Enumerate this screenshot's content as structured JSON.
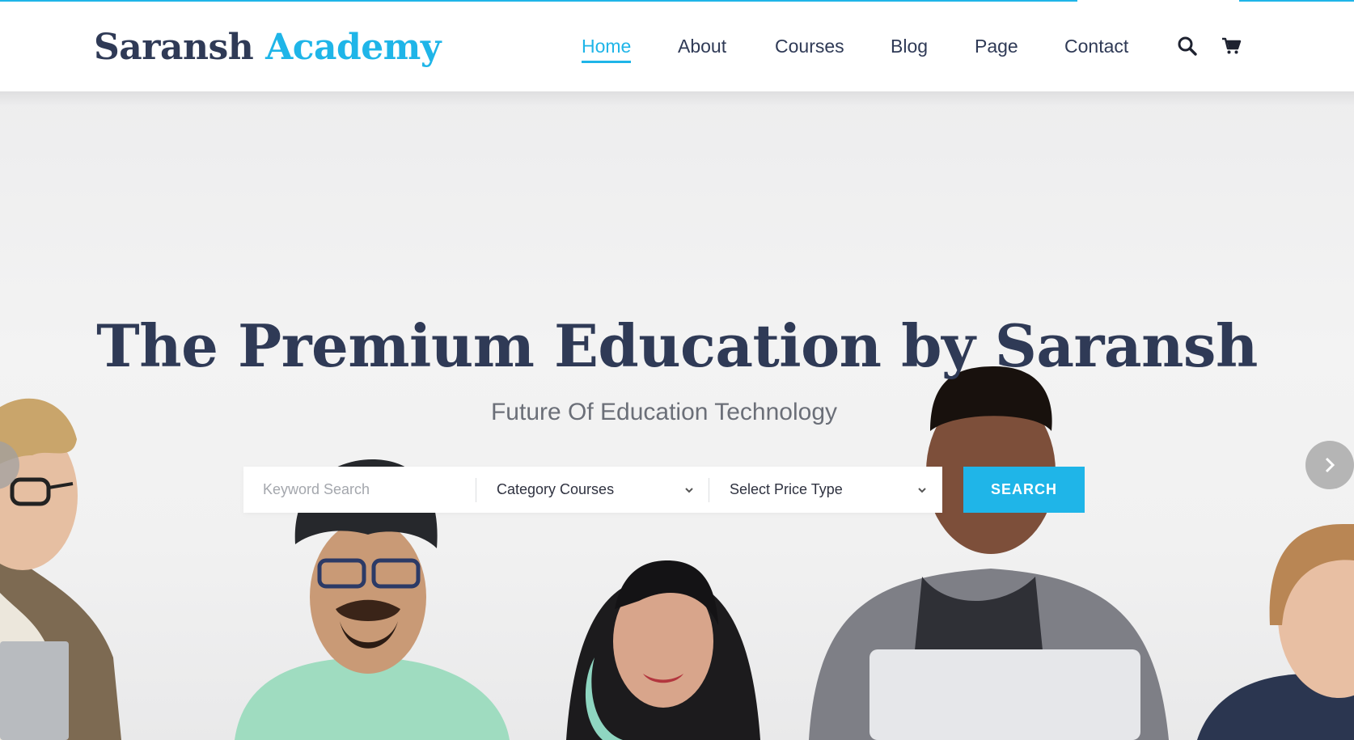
{
  "brand": {
    "word1": "Saransh",
    "word2": "Academy"
  },
  "nav": {
    "items": [
      {
        "label": "Home",
        "active": true
      },
      {
        "label": "About",
        "active": false
      },
      {
        "label": "Courses",
        "active": false
      },
      {
        "label": "Blog",
        "active": false
      },
      {
        "label": "Page",
        "active": false
      },
      {
        "label": "Contact",
        "active": false
      }
    ],
    "icons": [
      "search-icon",
      "cart-icon"
    ]
  },
  "hero": {
    "title": "The Premium Education by Saransh",
    "subtitle": "Future Of Education Technology"
  },
  "search": {
    "keyword_placeholder": "Keyword Search",
    "category_value": "Category Courses",
    "price_value": "Select Price Type",
    "button_label": "SEARCH"
  },
  "slider": {
    "prev_icon": "chevron-left-icon",
    "next_icon": "chevron-right-icon"
  },
  "colors": {
    "accent": "#1fb5e8",
    "heading": "#2f3a56",
    "subtitle": "#6b6f78"
  }
}
